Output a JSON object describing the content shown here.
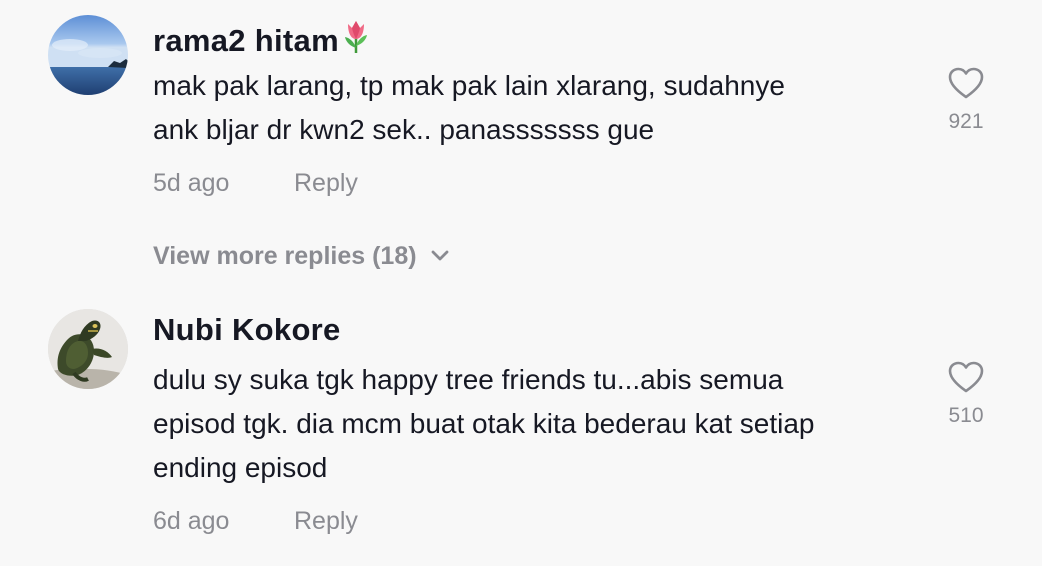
{
  "comments": [
    {
      "username": "rama2 hitam",
      "text_lines": [
        "mak pak larang, tp mak pak lain xlarang, sudahnye",
        "ank bljar dr kwn2 sek.. panasssssss gue"
      ],
      "time": "5d ago",
      "reply_label": "Reply",
      "likes": "921",
      "emoji": "tulip-icon"
    },
    {
      "username": "Nubi Kokore",
      "text_lines": [
        "dulu sy suka tgk happy tree friends tu...abis semua",
        "episod tgk. dia mcm buat otak kita bederau kat setiap",
        "ending episod"
      ],
      "time": "6d ago",
      "reply_label": "Reply",
      "likes": "510"
    }
  ],
  "view_more_replies": "View more replies (18)",
  "colors": {
    "primary_text": "#161823",
    "secondary_text": "#8a8b91",
    "background": "#f8f8f8"
  }
}
